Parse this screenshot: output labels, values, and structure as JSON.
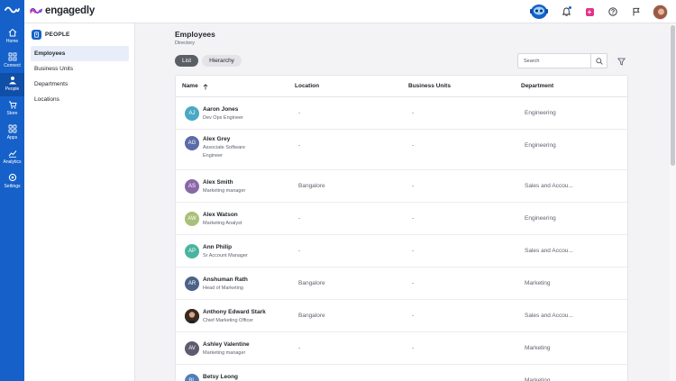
{
  "nav_rail": {
    "items": [
      {
        "label": "Home",
        "icon": "home-icon"
      },
      {
        "label": "Connect",
        "icon": "connect-icon"
      },
      {
        "label": "People",
        "icon": "people-icon"
      },
      {
        "label": "Store",
        "icon": "store-icon"
      },
      {
        "label": "Apps",
        "icon": "apps-icon"
      },
      {
        "label": "Analytics",
        "icon": "analytics-icon"
      },
      {
        "label": "Settings",
        "icon": "settings-icon"
      }
    ],
    "active": "People"
  },
  "header": {
    "brand": "engagedly",
    "icons": [
      "mascot-icon",
      "bell-icon",
      "plus-icon",
      "help-icon",
      "flag-icon",
      "avatar"
    ]
  },
  "sidebar": {
    "section_title": "PEOPLE",
    "items": [
      {
        "label": "Employees"
      },
      {
        "label": "Business Units"
      },
      {
        "label": "Departments"
      },
      {
        "label": "Locations"
      }
    ],
    "active": "Employees"
  },
  "main": {
    "title": "Employees",
    "subtitle": "Directory",
    "views": [
      {
        "label": "List"
      },
      {
        "label": "Hierarchy"
      }
    ],
    "active_view": "List",
    "search": {
      "placeholder": "Search",
      "value": ""
    },
    "table": {
      "columns": [
        {
          "label": "Name"
        },
        {
          "label": "Location"
        },
        {
          "label": "Business Units"
        },
        {
          "label": "Department"
        }
      ],
      "sort": {
        "column": "Name",
        "direction": "ascending"
      },
      "rows": [
        {
          "initials": "AJ",
          "name": "Aaron Jones",
          "title": "Dev Ops Engineer",
          "location": "-",
          "business_unit": "-",
          "department": "Engineering",
          "color": "#49a9c4"
        },
        {
          "initials": "AG",
          "name": "Alex Grey",
          "title": "Associate Software Engineer",
          "location": "-",
          "business_unit": "-",
          "department": "Engineering",
          "color": "#5c6aa8"
        },
        {
          "initials": "AS",
          "name": "Alex Smith",
          "title": "Marketing manager",
          "location": "Bangalore",
          "business_unit": "-",
          "department": "Sales and Accou...",
          "color": "#8a68a8"
        },
        {
          "initials": "AW",
          "name": "Alex Watson",
          "title": "Marketing Analyst",
          "location": "-",
          "business_unit": "-",
          "department": "Engineering",
          "color": "#a8c07a"
        },
        {
          "initials": "AP",
          "name": "Ann Philip",
          "title": "Sr Account Manager",
          "location": "-",
          "business_unit": "-",
          "department": "Sales and Accou...",
          "color": "#49b5a0"
        },
        {
          "initials": "AR",
          "name": "Anshuman Rath",
          "title": "Head of Marketing",
          "location": "Bangalore",
          "business_unit": "-",
          "department": "Marketing",
          "color": "#4d6288"
        },
        {
          "initials": "",
          "name": "Anthony Edward Stark",
          "title": "Chief Marketing Officer",
          "location": "Bangalore",
          "business_unit": "-",
          "department": "Sales and Accou...",
          "color": "#3a2a22"
        },
        {
          "initials": "AV",
          "name": "Ashley Valentine",
          "title": "Marketing manager",
          "location": "-",
          "business_unit": "-",
          "department": "Marketing",
          "color": "#5f5a6e"
        },
        {
          "initials": "BL",
          "name": "Betsy Leong",
          "title": "",
          "location": "",
          "business_unit": "",
          "department": "Marketing",
          "color": "#4e7fb8"
        }
      ]
    }
  },
  "colors": {
    "rail": "#1561c9",
    "accent_pink": "#e0338a",
    "active_pill": "#5b5f66"
  }
}
